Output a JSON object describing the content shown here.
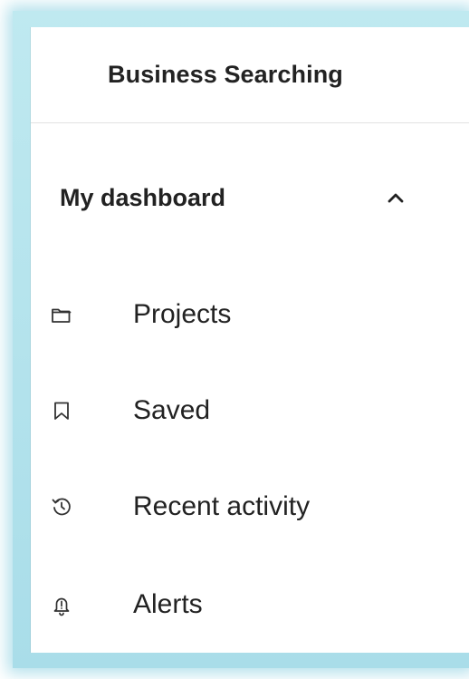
{
  "app": {
    "title": "Business Searching"
  },
  "dashboard": {
    "title": "My dashboard",
    "expanded": true,
    "toggle_icon": "chevron-up-icon",
    "items": [
      {
        "label": "Projects",
        "icon": "folder-icon"
      },
      {
        "label": "Saved",
        "icon": "bookmark-icon"
      },
      {
        "label": "Recent activity",
        "icon": "history-icon"
      },
      {
        "label": "Alerts",
        "icon": "bell-alert-icon"
      }
    ]
  },
  "colors": {
    "frame_glow": "#a9dde9",
    "text": "#222222",
    "divider": "#e2e2e2",
    "icon": "#333333"
  }
}
